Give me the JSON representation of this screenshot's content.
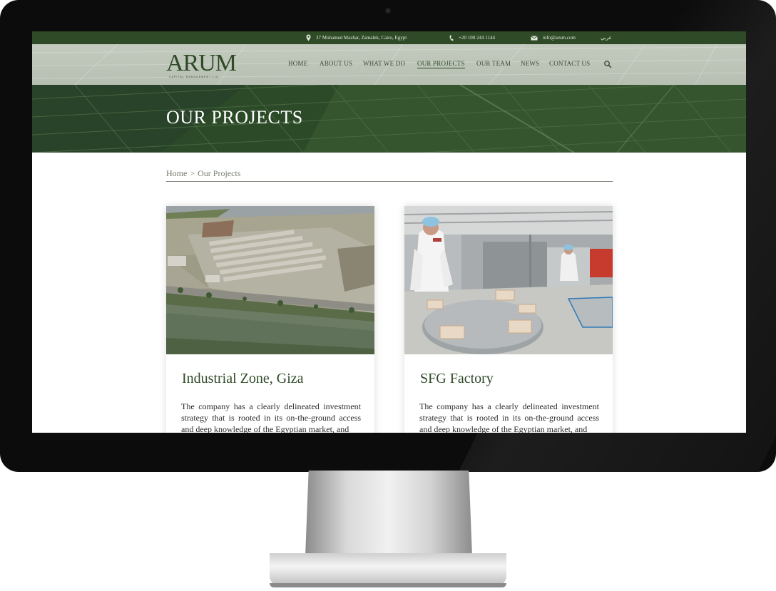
{
  "topbar": {
    "address": "37 Mohamed Mazhar, Zamalek, Cairo, Egypt",
    "phone": "+20 100 244 1144",
    "email": "info@arum.com",
    "language": "عربي",
    "address_icon": "location-pin-icon",
    "phone_icon": "phone-icon",
    "email_icon": "envelope-icon"
  },
  "brand": {
    "name": "ARUM",
    "tagline": "CAPITAL MANAGEMENT Ltd."
  },
  "nav": {
    "items": [
      {
        "label": "HOME"
      },
      {
        "label": "ABOUT US"
      },
      {
        "label": "WHAT WE DO"
      },
      {
        "label": "OUR PROJECTS",
        "active": true
      },
      {
        "label": "OUR TEAM"
      },
      {
        "label": "NEWS"
      },
      {
        "label": "CONTACT US"
      }
    ],
    "search_icon": "search-icon"
  },
  "banner": {
    "title": "OUR PROJECTS"
  },
  "breadcrumb": {
    "home": "Home",
    "separator": ">",
    "current": "Our Projects"
  },
  "projects": [
    {
      "title": "Industrial Zone, Giza",
      "text": "The company has a clearly delineated investment strategy that is rooted in its on-the-ground access and deep knowledge of the Egyptian market, and"
    },
    {
      "title": "SFG Factory",
      "text": "The company has a clearly delineated investment strategy that is rooted in its on-the-ground access and deep knowledge of the Egyptian market, and"
    }
  ],
  "colors": {
    "brand_green": "#2e4a26",
    "header_bg": "#bcc4b8",
    "bezel": "#0c0c0c"
  }
}
